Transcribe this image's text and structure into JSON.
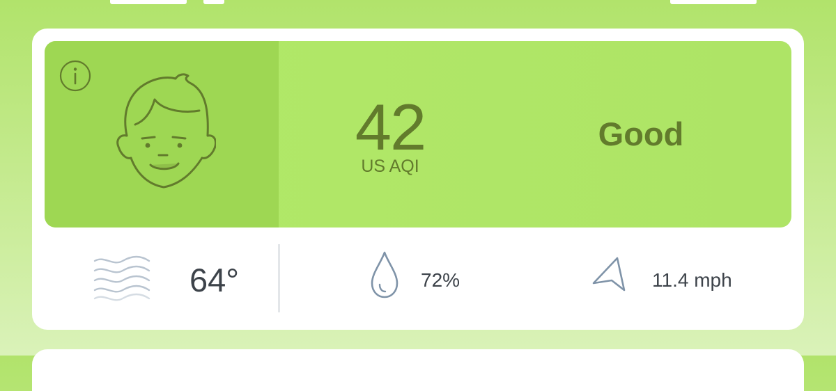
{
  "aqi": {
    "value": "42",
    "unit": "US AQI",
    "status": "Good"
  },
  "weather": {
    "temperature": "64°",
    "humidity": "72%",
    "wind_speed": "11.4 mph"
  },
  "icons": {
    "info": "info-icon",
    "face": "happy-face-icon",
    "haze": "haze-icon",
    "humidity": "water-drop-icon",
    "wind": "wind-direction-icon"
  },
  "colors": {
    "aqi_good_bg": "#b1e968",
    "aqi_face_bg": "#9ed753",
    "aqi_text": "#627b2c",
    "weather_text": "#3d434a",
    "weather_icon": "#7f93a8"
  }
}
